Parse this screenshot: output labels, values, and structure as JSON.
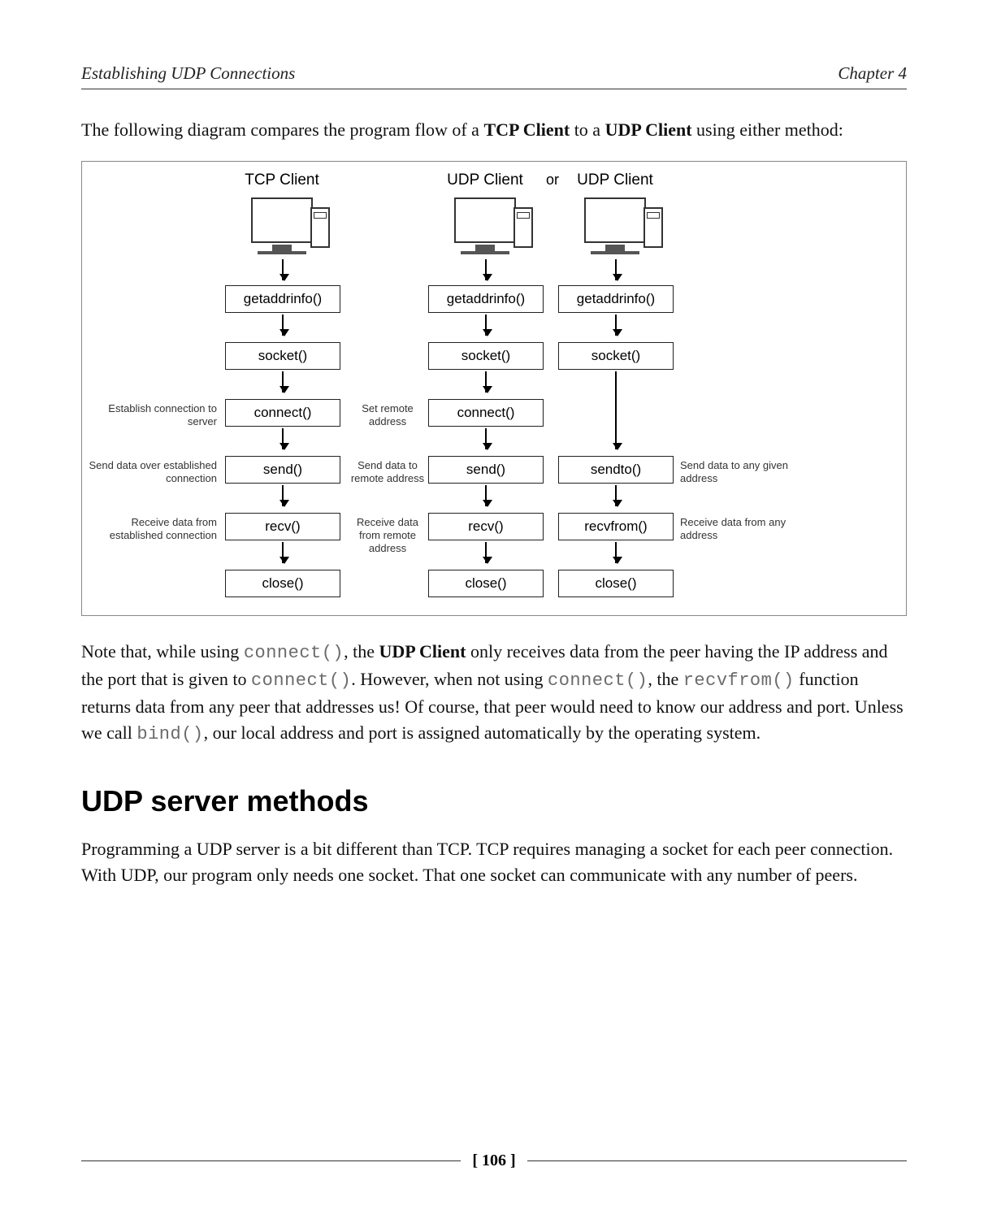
{
  "header": {
    "left": "Establishing UDP Connections",
    "right": "Chapter 4"
  },
  "intro": {
    "pre": "The following diagram compares the program flow of a ",
    "bold1": "TCP Client",
    "mid": " to a ",
    "bold2": "UDP Client",
    "post": " using either method:"
  },
  "figure": {
    "titles": {
      "tcp": "TCP Client",
      "udp1": "UDP Client",
      "or": "or",
      "udp2": "UDP Client"
    },
    "steps": {
      "getaddrinfo": "getaddrinfo()",
      "socket": "socket()",
      "connect": "connect()",
      "send": "send()",
      "sendto": "sendto()",
      "recv": "recv()",
      "recvfrom": "recvfrom()",
      "close": "close()"
    },
    "notes": {
      "tcp_connect": "Establish connection to server",
      "tcp_send": "Send data over established connection",
      "tcp_recv": "Receive data from established connection",
      "udp_connect": "Set remote address",
      "udp_send": "Send data to remote address",
      "udp_recv": "Receive data from remote address",
      "udp2_send": "Send data to any given address",
      "udp2_recv": "Receive data from any address"
    }
  },
  "note_para": {
    "t1": "Note that, while using ",
    "c1": "connect()",
    "t2": ", the ",
    "b1": "UDP Client",
    "t3": " only receives data from the peer having the IP address and the port that is given to ",
    "c2": "connect()",
    "t4": ". However, when not using ",
    "c3": "connect()",
    "t5": ", the ",
    "c4": "recvfrom()",
    "t6": " function returns data from any peer that addresses us! Of course, that peer would need to know our address and port. Unless we call ",
    "c5": "bind()",
    "t7": ", our local address and port is assigned automatically by the operating system."
  },
  "section": {
    "heading": "UDP server methods",
    "body": "Programming a UDP server is a bit different than TCP. TCP requires managing a socket for each peer connection. With UDP, our program only needs one socket. That one socket can communicate with any number of peers."
  },
  "footer": {
    "page": "[ 106 ]"
  }
}
